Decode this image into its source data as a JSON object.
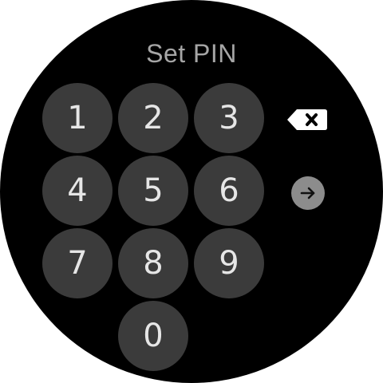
{
  "screen": {
    "title": "Set PIN"
  },
  "keypad": {
    "keys": [
      "1",
      "2",
      "3",
      "4",
      "5",
      "6",
      "7",
      "8",
      "9",
      "0"
    ]
  },
  "actions": {
    "backspace_icon": "backspace-icon",
    "submit_icon": "arrow-right-icon"
  },
  "colors": {
    "background": "#000000",
    "key_background": "#3b3b3b",
    "key_text": "#e6e6e6",
    "title_text": "#a6a6a6",
    "submit_background": "#8c8c8c"
  }
}
